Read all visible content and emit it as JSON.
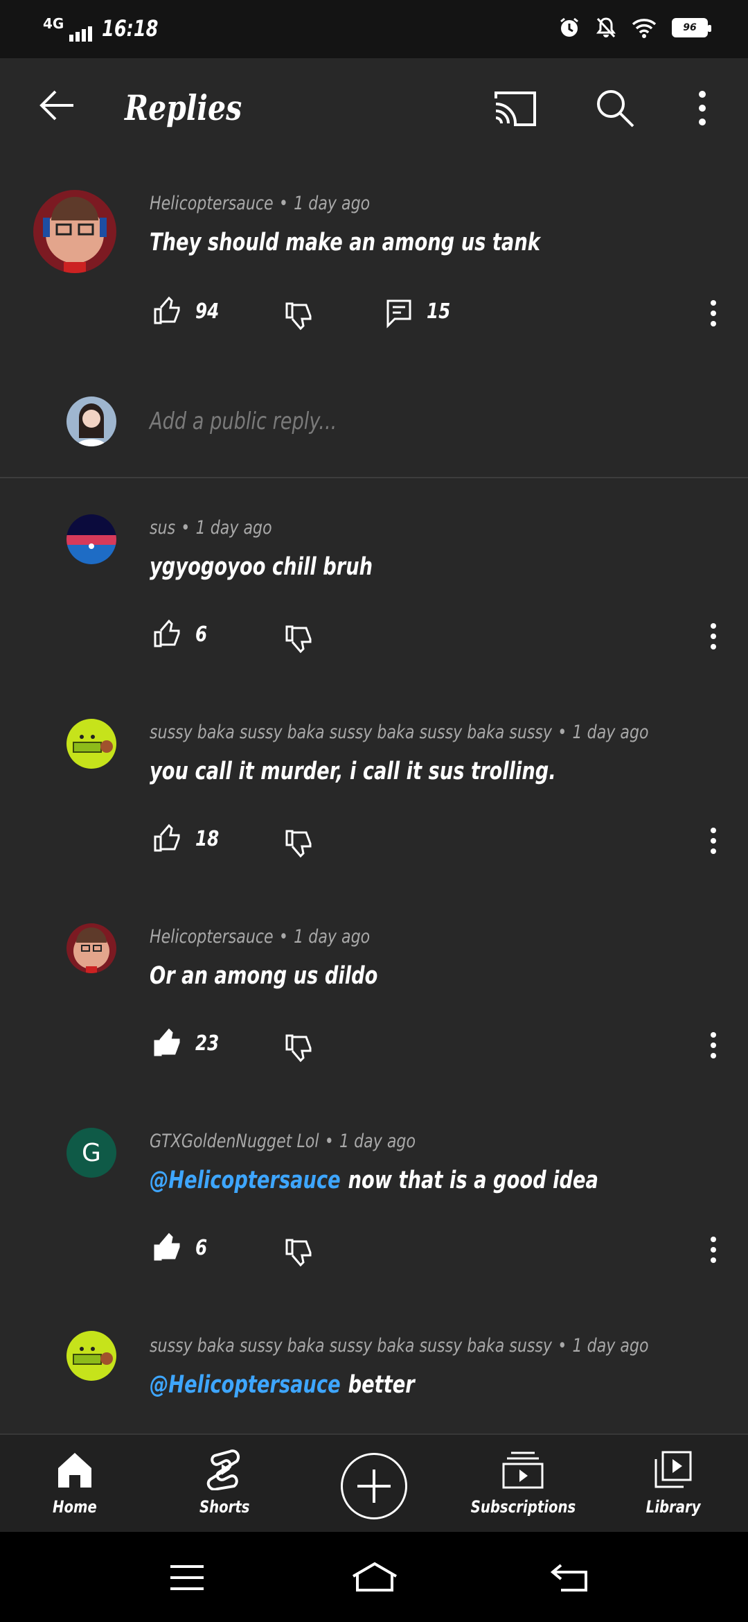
{
  "status_bar": {
    "network": "4G",
    "time": "16:18",
    "battery": "96"
  },
  "app_bar": {
    "title": "Replies"
  },
  "parent_comment": {
    "author": "Helicoptersauce",
    "time": "1 day ago",
    "text": "They should make an among us tank",
    "likes": "94",
    "replies": "15"
  },
  "reply_input": {
    "placeholder": "Add a public reply..."
  },
  "replies": [
    {
      "author": "sus",
      "time": "1 day ago",
      "mention": "",
      "text": "ygyogoyoo chill bruh",
      "likes": "6",
      "liked": false
    },
    {
      "author": "sussy baka sussy baka sussy baka sussy baka sussy",
      "time": "1 day ago",
      "mention": "",
      "text": "you call it murder, i call it sus trolling.",
      "likes": "18",
      "liked": false
    },
    {
      "author": "Helicoptersauce",
      "time": "1 day ago",
      "mention": "",
      "text": "Or an among us dildo",
      "likes": "23",
      "liked": true
    },
    {
      "author": "GTXGoldenNugget Lol",
      "time": "1 day ago",
      "mention": "@Helicoptersauce",
      "text": "now that is a good idea",
      "likes": "6",
      "liked": true,
      "avatar_letter": "G"
    },
    {
      "author": "sussy baka sussy baka sussy baka sussy baka sussy",
      "time": "1 day ago",
      "mention": "@Helicoptersauce",
      "text": "better",
      "likes": "",
      "liked": false
    }
  ],
  "bottom_nav": {
    "home": "Home",
    "shorts": "Shorts",
    "subscriptions": "Subscriptions",
    "library": "Library"
  },
  "colors": {
    "background": "#282828",
    "mention": "#3ea6ff",
    "meta": "#a9a9a9"
  }
}
